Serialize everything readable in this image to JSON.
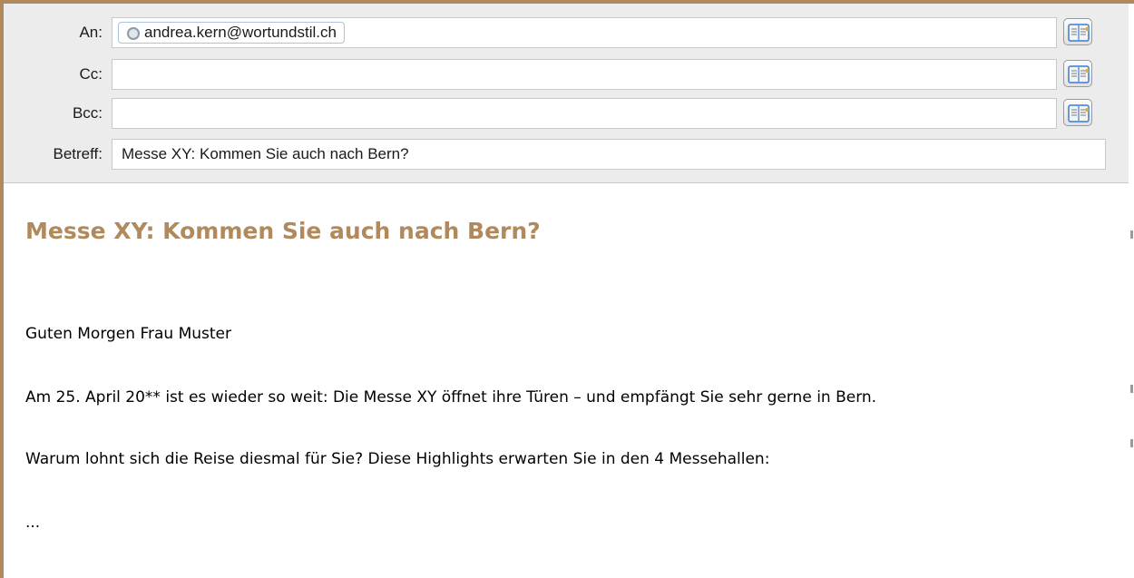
{
  "compose": {
    "to": {
      "label": "An:",
      "recipient": "andrea.kern@wortundstil.ch"
    },
    "cc": {
      "label": "Cc:",
      "value": ""
    },
    "bcc": {
      "label": "Bcc:",
      "value": ""
    },
    "subject": {
      "label": "Betreff:",
      "value": "Messe XY: Kommen Sie auch nach Bern?"
    },
    "address_book_icon": "address-book-icon"
  },
  "message": {
    "heading": "Messe XY: Kommen Sie auch nach Bern?",
    "greeting": "Guten Morgen Frau Muster",
    "paragraph1": "Am 25. April 20** ist es wieder so weit: Die Messe XY öffnet ihre Türen – und empfängt Sie sehr gerne in Bern.",
    "paragraph2": "Warum lohnt sich die Reise diesmal für Sie? Diese Highlights erwarten Sie in den 4 Messehallen:",
    "ellipsis": "..."
  },
  "colors": {
    "accent": "#b08a5c",
    "header_bg": "#ececec"
  }
}
